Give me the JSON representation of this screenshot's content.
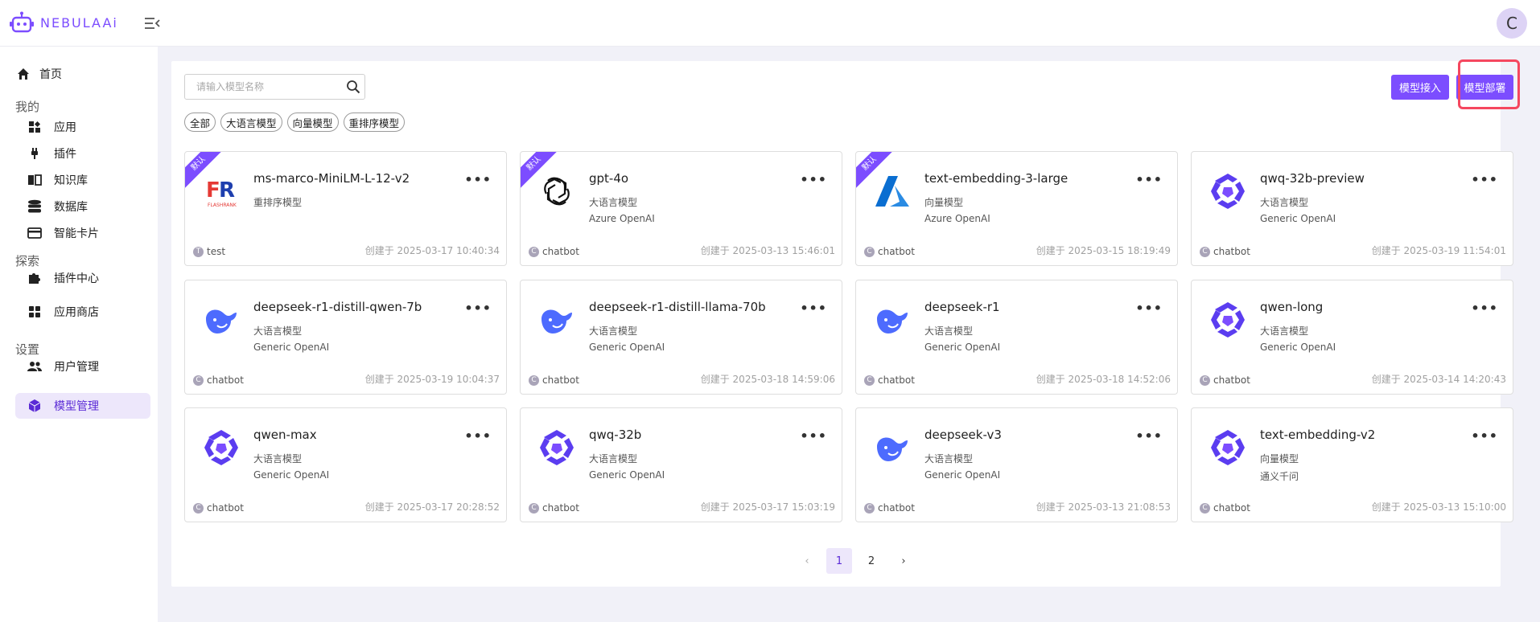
{
  "header": {
    "logo_text": "NEBULAAi",
    "avatar_letter": "C"
  },
  "sidebar": {
    "home": "首页",
    "section_mine": "我的",
    "apps": "应用",
    "plugins": "插件",
    "knowledge": "知识库",
    "database": "数据库",
    "smart_card": "智能卡片",
    "section_explore": "探索",
    "plugin_center": "插件中心",
    "app_store": "应用商店",
    "section_settings": "设置",
    "user_mgmt": "用户管理",
    "model_mgmt": "模型管理"
  },
  "toolbar": {
    "search_placeholder": "请输入模型名称",
    "filters": [
      "全部",
      "大语言模型",
      "向量模型",
      "重排序模型"
    ],
    "connect_label": "模型接入",
    "deploy_label": "模型部署"
  },
  "cards": [
    {
      "name": "ms-marco-MiniLM-L-12-v2",
      "type": "重排序模型",
      "provider": "",
      "owner": "test",
      "owner_initial": "T",
      "created": "创建于 2025-03-17 10:40:34",
      "badge": "默认",
      "logo": "flashrank-logo"
    },
    {
      "name": "gpt-4o",
      "type": "大语言模型",
      "provider": "Azure OpenAI",
      "owner": "chatbot",
      "owner_initial": "C",
      "created": "创建于 2025-03-13 15:46:01",
      "badge": "默认",
      "logo": "openai-logo"
    },
    {
      "name": "text-embedding-3-large",
      "type": "向量模型",
      "provider": "Azure OpenAI",
      "owner": "chatbot",
      "owner_initial": "C",
      "created": "创建于 2025-03-15 18:19:49",
      "badge": "默认",
      "logo": "azure-logo"
    },
    {
      "name": "qwq-32b-preview",
      "type": "大语言模型",
      "provider": "Generic OpenAI",
      "owner": "chatbot",
      "owner_initial": "C",
      "created": "创建于 2025-03-19 11:54:01",
      "badge": "",
      "logo": "qwen-logo"
    },
    {
      "name": "deepseek-r1-distill-qwen-7b",
      "type": "大语言模型",
      "provider": "Generic OpenAI",
      "owner": "chatbot",
      "owner_initial": "C",
      "created": "创建于 2025-03-19 10:04:37",
      "badge": "",
      "logo": "deepseek-logo"
    },
    {
      "name": "deepseek-r1-distill-llama-70b",
      "type": "大语言模型",
      "provider": "Generic OpenAI",
      "owner": "chatbot",
      "owner_initial": "C",
      "created": "创建于 2025-03-18 14:59:06",
      "badge": "",
      "logo": "deepseek-logo"
    },
    {
      "name": "deepseek-r1",
      "type": "大语言模型",
      "provider": "Generic OpenAI",
      "owner": "chatbot",
      "owner_initial": "C",
      "created": "创建于 2025-03-18 14:52:06",
      "badge": "",
      "logo": "deepseek-logo"
    },
    {
      "name": "qwen-long",
      "type": "大语言模型",
      "provider": "Generic OpenAI",
      "owner": "chatbot",
      "owner_initial": "C",
      "created": "创建于 2025-03-14 14:20:43",
      "badge": "",
      "logo": "qwen-logo"
    },
    {
      "name": "qwen-max",
      "type": "大语言模型",
      "provider": "Generic OpenAI",
      "owner": "chatbot",
      "owner_initial": "C",
      "created": "创建于 2025-03-17 20:28:52",
      "badge": "",
      "logo": "qwen-logo"
    },
    {
      "name": "qwq-32b",
      "type": "大语言模型",
      "provider": "Generic OpenAI",
      "owner": "chatbot",
      "owner_initial": "C",
      "created": "创建于 2025-03-17 15:03:19",
      "badge": "",
      "logo": "qwen-logo"
    },
    {
      "name": "deepseek-v3",
      "type": "大语言模型",
      "provider": "Generic OpenAI",
      "owner": "chatbot",
      "owner_initial": "C",
      "created": "创建于 2025-03-13 21:08:53",
      "badge": "",
      "logo": "deepseek-logo"
    },
    {
      "name": "text-embedding-v2",
      "type": "向量模型",
      "provider": "通义千问",
      "owner": "chatbot",
      "owner_initial": "C",
      "created": "创建于 2025-03-13 15:10:00",
      "badge": "",
      "logo": "qwen-logo"
    }
  ],
  "pagination": {
    "pages": [
      "1",
      "2"
    ],
    "current": "1"
  },
  "colors": {
    "accent": "#7c4dff",
    "highlight": "#f5475f"
  }
}
